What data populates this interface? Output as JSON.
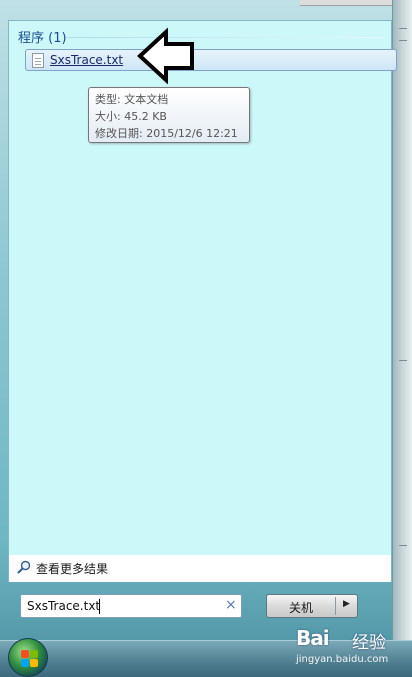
{
  "start_menu": {
    "section_header": "程序 (1)",
    "results": [
      {
        "label": "SxsTrace.txt",
        "icon": "text-file-icon"
      }
    ],
    "tooltip": {
      "type": "类型: 文本文档",
      "size": "大小: 45.2 KB",
      "modified": "修改日期: 2015/12/6 12:21"
    },
    "see_more_label": "查看更多结果",
    "search": {
      "value": "SxsTrace.txt",
      "clear_icon": "×"
    },
    "shutdown": {
      "label": "关机",
      "arrow": "▶"
    }
  },
  "watermark": {
    "logo": "Bai",
    "suffix": "经验",
    "url": "jingyan.baidu.com"
  },
  "colors": {
    "panel_bg": "#ccf8fa",
    "header_text": "#1a4e91",
    "taskbar": "#4f7e90"
  }
}
